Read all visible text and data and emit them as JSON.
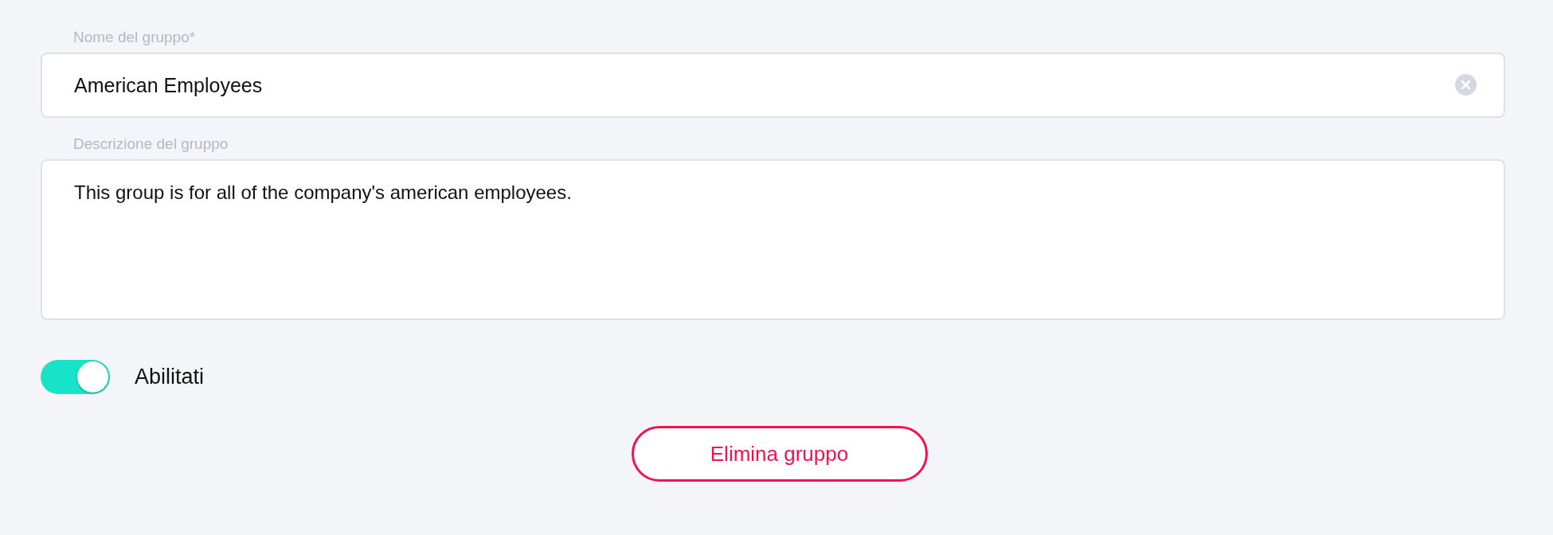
{
  "name_field": {
    "label": "Nome del gruppo*",
    "value": "American Employees"
  },
  "description_field": {
    "label": "Descrizione del gruppo",
    "value": "This group is for all of the company's american employees."
  },
  "enabled_toggle": {
    "label": "Abilitati",
    "on": true
  },
  "delete_button": {
    "label": "Elimina gruppo"
  }
}
